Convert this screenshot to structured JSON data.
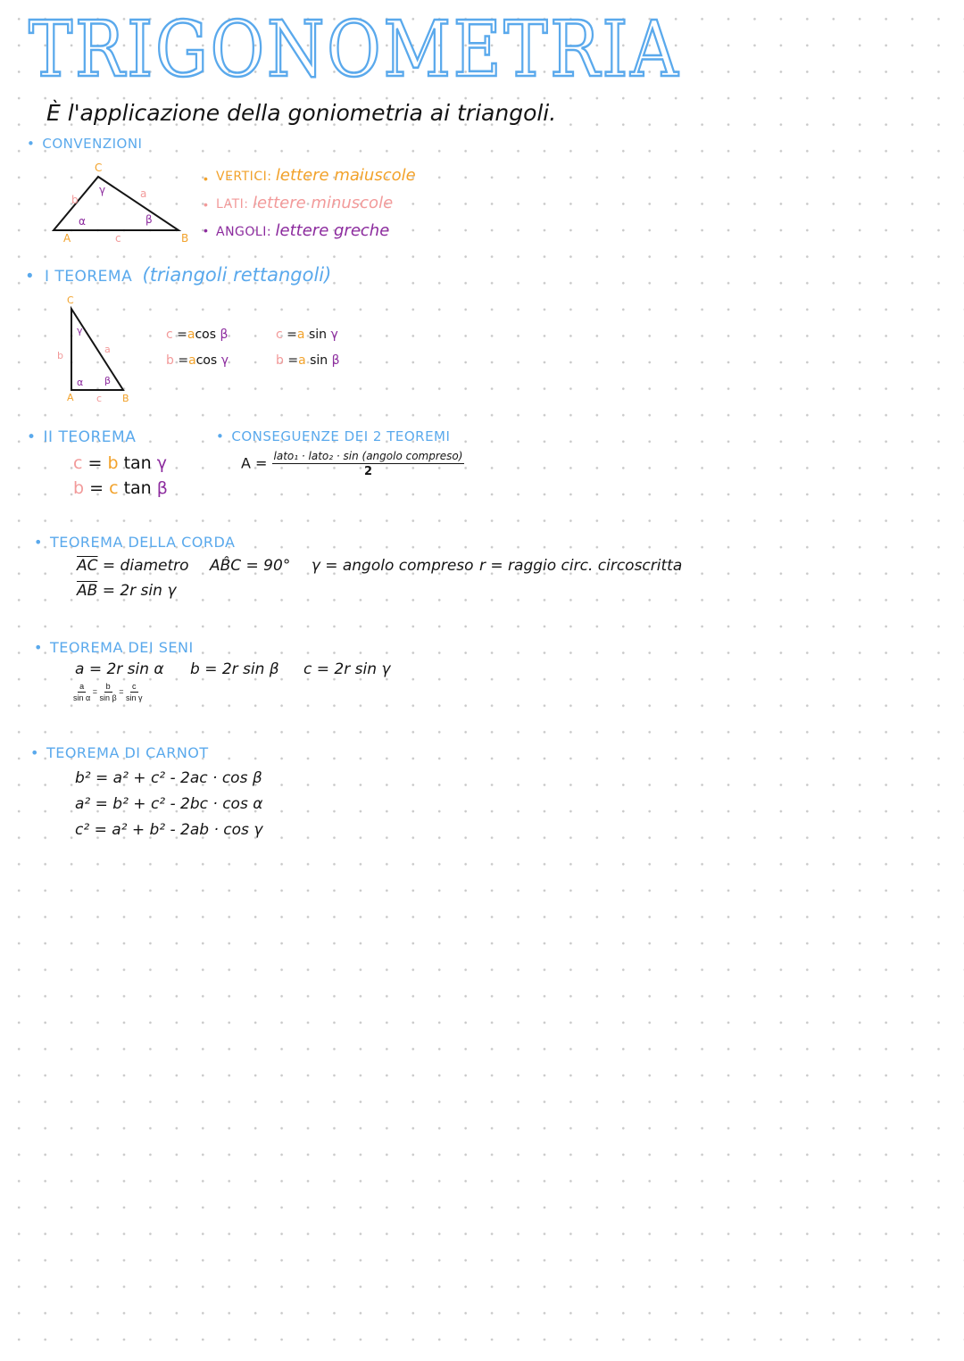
{
  "title": "TRIGONOMETRIA",
  "intro": "È l'applicazione della goniometria ai triangoli.",
  "convenzioni": {
    "heading": "CONVENZIONI",
    "triangle": {
      "vertices": [
        "A",
        "B",
        "C"
      ],
      "sides": [
        "a",
        "b",
        "c"
      ],
      "angles": [
        "α",
        "β",
        "γ"
      ]
    },
    "legend": [
      {
        "key": "VERTICI:",
        "value": "lettere maiuscole",
        "color": "#f2a22b"
      },
      {
        "key": "LATI:",
        "value": "lettere minuscole",
        "color": "#f29a9a"
      },
      {
        "key": "ANGOLI:",
        "value": "lettere greche",
        "color": "#8c2b9e"
      }
    ]
  },
  "teorema1": {
    "heading": "I TEOREMA (triangoli rettangoli)",
    "heading_main": "I TEOREMA",
    "heading_note": "(triangoli rettangoli)",
    "triangle": {
      "vertices": [
        "A",
        "B",
        "C"
      ],
      "sides": [
        "a",
        "b",
        "c"
      ],
      "angles": [
        "α",
        "β",
        "γ"
      ]
    },
    "formulas": [
      {
        "lhs": "c",
        "coef": "a",
        "fn": "cos",
        "angle": "β"
      },
      {
        "lhs": "b",
        "coef": "a",
        "fn": "cos",
        "angle": "γ"
      },
      {
        "lhs": "c",
        "coef": "a",
        "fn": "sin",
        "angle": "γ"
      },
      {
        "lhs": "b",
        "coef": "a",
        "fn": "sin",
        "angle": "β"
      }
    ]
  },
  "teorema2": {
    "heading": "II TEOREMA",
    "formulas": [
      {
        "lhs": "c",
        "coef": "b",
        "fn": "tan",
        "angle": "γ"
      },
      {
        "lhs": "b",
        "coef": "c",
        "fn": "tan",
        "angle": "β"
      }
    ]
  },
  "conseguenze": {
    "heading": "CONSEGUENZE dei 2 TEOREMI",
    "lhs": "A =",
    "numerator": "lato₁ · lato₂ · sin (angolo compreso)",
    "denominator": "2"
  },
  "corda": {
    "heading": "TEOREMA DELLA CORDA",
    "line1": [
      {
        "seg": "AC",
        "text": " = diametro"
      },
      {
        "text": "AB̂C = 90°"
      },
      {
        "text": "γ = angolo compreso"
      },
      {
        "text": "r = raggio circ. circoscritta"
      }
    ],
    "line2": {
      "seg": "AB",
      "text": " = 2r sin γ"
    }
  },
  "seni": {
    "heading": "TEOREMA DEI SENI",
    "formulas": [
      "a = 2r sin α",
      "b = 2r sin β",
      "c = 2r sin γ"
    ],
    "ratio": [
      {
        "num": "a",
        "den": "sin α"
      },
      {
        "num": "b",
        "den": "sin β"
      },
      {
        "num": "c",
        "den": "sin γ"
      }
    ],
    "eq": "="
  },
  "carnot": {
    "heading": "TEOREMA di CARNOT",
    "formulas": [
      "b² = a² + c² - 2ac · cos β",
      "a² = b² + c² - 2bc · cos α",
      "c² = a² + b² - 2ab · cos γ"
    ]
  },
  "colors": {
    "heading": "#5aa9ec",
    "vertex": "#f2a22b",
    "side": "#f29a9a",
    "angle": "#8c2b9e",
    "ink": "#141414"
  }
}
